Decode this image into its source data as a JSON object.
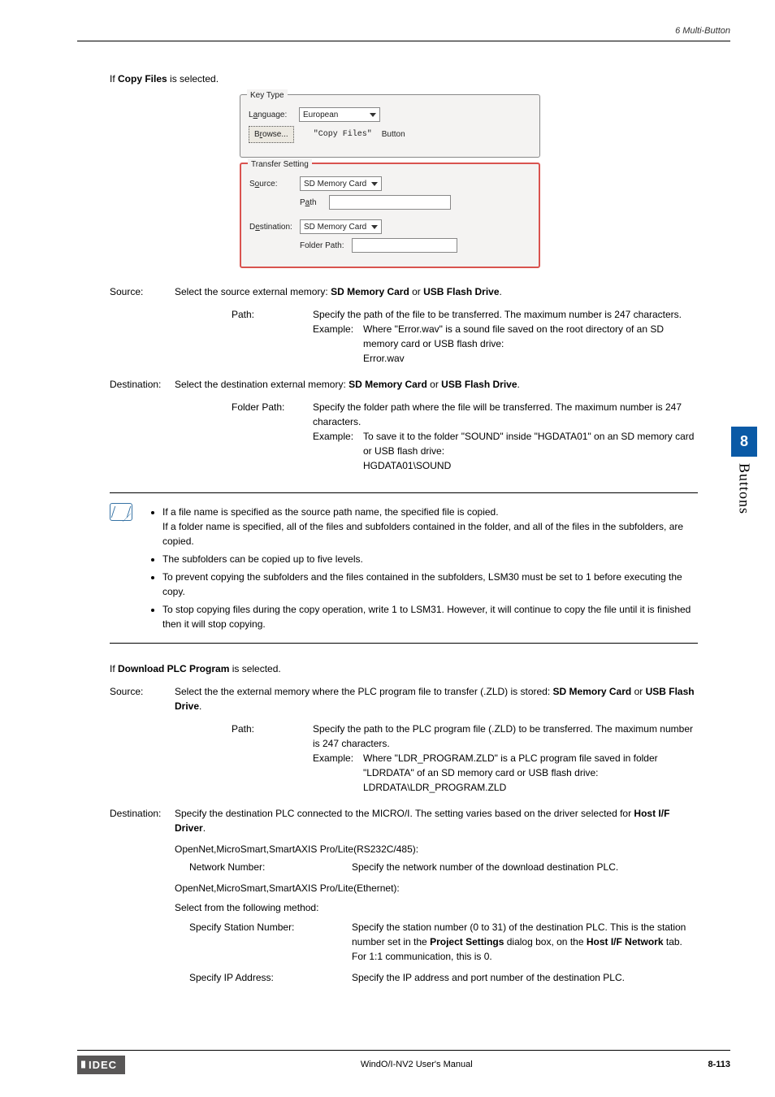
{
  "header": {
    "section_label": "6 Multi-Button"
  },
  "intro1": {
    "prefix": "If ",
    "bold": "Copy Files",
    "suffix": " is selected."
  },
  "mock": {
    "group1": {
      "legend": "Key Type",
      "lang_label_pre": "L",
      "lang_label_und": "a",
      "lang_label_post": "nguage:",
      "lang_value": "European",
      "browse_pre": "B",
      "browse_und": "r",
      "browse_post": "owse...",
      "copy_btn": "\"Copy Files\"",
      "button_word": "Button"
    },
    "group2": {
      "legend": "Transfer Setting",
      "source_pre": "S",
      "source_und": "o",
      "source_post": "urce:",
      "source_value": "SD Memory Card",
      "path_pre": "P",
      "path_und": "a",
      "path_post": "th",
      "dest_pre": "D",
      "dest_und": "e",
      "dest_post": "stination:",
      "dest_value": "SD Memory Card",
      "folder_label": "Folder Path:"
    }
  },
  "source_block": {
    "term": "Source:",
    "desc_pre": "Select the source external memory: ",
    "desc_b1": "SD Memory Card",
    "desc_mid": " or ",
    "desc_b2": "USB Flash Drive",
    "desc_end": ".",
    "path_term": "Path:",
    "path_desc": "Specify the path of the file to be transferred. The maximum number is 247 characters.",
    "ex_label": "Example:",
    "ex_text": "Where \"Error.wav\" is a sound file saved on the root directory of an SD memory card or USB flash drive:",
    "ex_value": "Error.wav"
  },
  "dest_block": {
    "term": "Destination:",
    "desc_pre": "Select the destination external memory: ",
    "desc_b1": "SD Memory Card",
    "desc_mid": " or ",
    "desc_b2": "USB Flash Drive",
    "desc_end": ".",
    "folder_term": "Folder Path:",
    "folder_desc": "Specify the folder path where the file will be transferred. The maximum number is 247 characters.",
    "ex_label": "Example:",
    "ex_text": "To save it to the folder \"SOUND\" inside \"HGDATA01\" on an SD memory card or USB flash drive:",
    "ex_value": "HGDATA01\\SOUND"
  },
  "note": {
    "b1a": "If a file name is specified as the source path name, the specified file is copied.",
    "b1b": "If a folder name is specified, all of the files and subfolders contained in the folder, and all of the files in the subfolders, are copied.",
    "b2": "The subfolders can be copied up to five levels.",
    "b3": "To prevent copying the subfolders and the files contained in the subfolders, LSM30 must be set to 1 before executing the copy.",
    "b4": "To stop copying files during the copy operation, write 1 to LSM31. However, it will continue to copy the file until it is finished then it will stop copying."
  },
  "intro2": {
    "prefix": "If ",
    "bold": "Download PLC Program",
    "suffix": " is selected."
  },
  "plc_source": {
    "term": "Source:",
    "desc_pre": "Select the the external memory where the PLC program file to transfer (.ZLD) is stored: ",
    "desc_b1": "SD Memory Card",
    "desc_mid": " or ",
    "desc_b2": "USB Flash Drive",
    "desc_end": ".",
    "path_term": "Path:",
    "path_desc": "Specify the path to the PLC program file (.ZLD) to be transferred. The maximum number is 247 characters.",
    "ex_label": "Example:",
    "ex_text": "Where \"LDR_PROGRAM.ZLD\" is a PLC program file saved in folder \"LDRDATA\" of an SD memory card or USB flash drive:",
    "ex_value": "LDRDATA\\LDR_PROGRAM.ZLD"
  },
  "plc_dest": {
    "term": "Destination:",
    "desc_pre": "Specify the destination PLC connected to the MICRO/I. The setting varies based on the driver selected for ",
    "desc_b1": "Host I/F Driver",
    "desc_end": ".",
    "line1": "OpenNet,MicroSmart,SmartAXIS Pro/Lite(RS232C/485):",
    "nn_label": "Network Number:",
    "nn_desc": "Specify the network number of the download destination PLC.",
    "line2": "OpenNet,MicroSmart,SmartAXIS Pro/Lite(Ethernet):",
    "method_intro": "Select from the following method:",
    "sn_label": "Specify Station Number:",
    "sn_desc_pre": "Specify the station number (0 to 31) of the destination PLC. This is the station number set in the ",
    "sn_desc_b1": "Project Settings",
    "sn_desc_mid": " dialog box, on the ",
    "sn_desc_b2": "Host I/F Network",
    "sn_desc_post": " tab. For 1:1 communication, this is 0.",
    "ip_label": "Specify IP Address:",
    "ip_desc": "Specify the IP address and port number of the destination PLC."
  },
  "sidetab": {
    "num": "8",
    "text": "Buttons"
  },
  "footer": {
    "logo": "IDEC",
    "title": "WindO/I-NV2 User's Manual",
    "page": "8-113"
  }
}
